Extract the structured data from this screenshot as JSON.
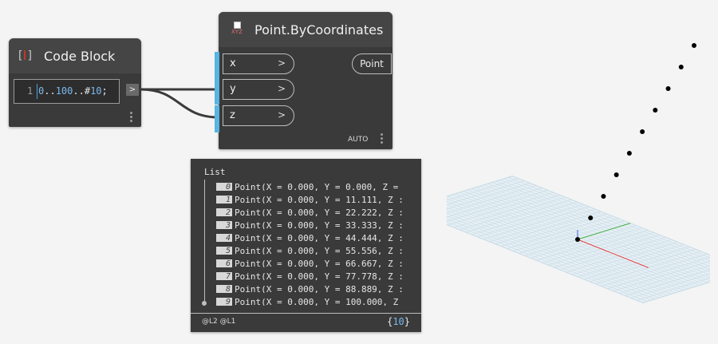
{
  "code_block": {
    "title": "Code Block",
    "icon": "code-block-icon",
    "line_number": "1",
    "code_parts": [
      "0",
      "..",
      "100",
      "..",
      "#",
      "10",
      ";"
    ],
    "output_arrow": ">"
  },
  "point_node": {
    "title": "Point.ByCoordinates",
    "icon_label": "XYZ",
    "inputs": [
      {
        "label": "x",
        "arrow": ">"
      },
      {
        "label": "y",
        "arrow": ">"
      },
      {
        "label": "z",
        "arrow": ">"
      }
    ],
    "output": "Point",
    "lacing": "AUTO"
  },
  "watch": {
    "list_label": "List",
    "items": [
      {
        "index": "0",
        "text": "Point(X = 0.000, Y = 0.000, Z ="
      },
      {
        "index": "1",
        "text": "Point(X = 0.000, Y = 11.111, Z :"
      },
      {
        "index": "2",
        "text": "Point(X = 0.000, Y = 22.222, Z :"
      },
      {
        "index": "3",
        "text": "Point(X = 0.000, Y = 33.333, Z :"
      },
      {
        "index": "4",
        "text": "Point(X = 0.000, Y = 44.444, Z :"
      },
      {
        "index": "5",
        "text": "Point(X = 0.000, Y = 55.556, Z :"
      },
      {
        "index": "6",
        "text": "Point(X = 0.000, Y = 66.667, Z :"
      },
      {
        "index": "7",
        "text": "Point(X = 0.000, Y = 77.778, Z :"
      },
      {
        "index": "8",
        "text": "Point(X = 0.000, Y = 88.889, Z :"
      },
      {
        "index": "9",
        "text": "Point(X = 0.000, Y = 100.000, Z"
      }
    ],
    "levels": "@L2 @L1",
    "count_open": "{",
    "count": "10",
    "count_close": "}"
  },
  "viewport": {
    "point_count": 10,
    "colors": {
      "grid": "#c8dbe6",
      "x_axis": "#e04040",
      "y_axis": "#40b040",
      "z_axis": "#4060e0",
      "points": "#000000"
    }
  },
  "colors": {
    "node_body": "#3a3a3a",
    "node_header": "#454545",
    "port_accent": "#58b4e0",
    "background": "#f4f4f4"
  }
}
